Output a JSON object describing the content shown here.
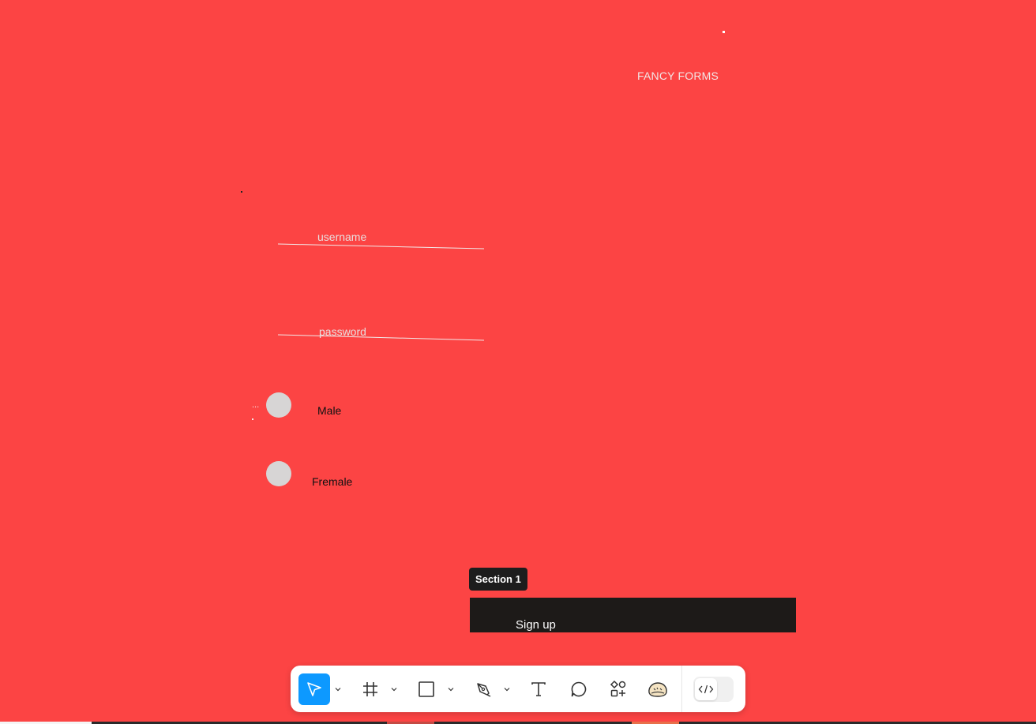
{
  "canvas": {
    "background_color": "#fc4444",
    "title": "FANCY FORMS"
  },
  "form": {
    "username_label": "username",
    "password_label": "password",
    "gender_options": [
      "Male",
      "Fremale"
    ],
    "ellipsis": "..."
  },
  "section": {
    "badge_label": "Section 1",
    "signup_label": "Sign up"
  },
  "toolbar": {
    "tools": [
      {
        "name": "move",
        "icon": "cursor-arrow-icon",
        "active": true
      },
      {
        "name": "frame",
        "icon": "hash-frame-icon",
        "active": false
      },
      {
        "name": "shape",
        "icon": "rectangle-icon",
        "active": false
      },
      {
        "name": "pen",
        "icon": "pen-nib-icon",
        "active": false
      },
      {
        "name": "text",
        "icon": "text-T-icon",
        "active": false
      },
      {
        "name": "comment",
        "icon": "speech-bubble-icon",
        "active": false
      },
      {
        "name": "actions",
        "icon": "shapes-plus-icon",
        "active": false
      },
      {
        "name": "ai",
        "icon": "blob-face-icon",
        "active": false
      }
    ],
    "dev_mode_icon": "code-brackets-icon",
    "accent_color": "#0d99ff"
  }
}
